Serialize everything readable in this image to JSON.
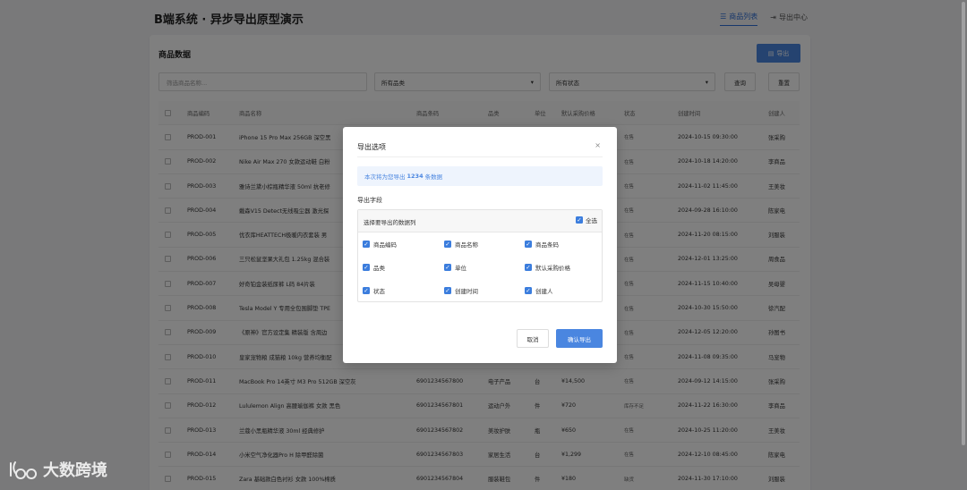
{
  "app": {
    "title": "B端系统 · 异步导出原型演示"
  },
  "nav": [
    {
      "label": "商品列表",
      "icon": "list-icon",
      "active": true
    },
    {
      "label": "导出中心",
      "icon": "export-icon",
      "active": false
    }
  ],
  "card": {
    "title": "商品数据",
    "export_label": "导出"
  },
  "filters": {
    "search_placeholder": "筛选商品名称...",
    "category_value": "所有品类",
    "status_value": "所有状态",
    "query_label": "查询",
    "reset_label": "重置"
  },
  "table": {
    "headers": [
      "商品编码",
      "商品名称",
      "商品条码",
      "品类",
      "单位",
      "默认采购价格",
      "状态",
      "创建时间",
      "创建人"
    ],
    "rows": [
      [
        "PROD-001",
        "iPhone 15 Pro Max 256GB 深空黑",
        "",
        "",
        "",
        "",
        "在售",
        "2024-10-15 09:30:00",
        "张采购"
      ],
      [
        "PROD-002",
        "Nike Air Max 270 女款运动鞋 白粉",
        "",
        "",
        "",
        "",
        "在售",
        "2024-10-18 14:20:00",
        "李商品"
      ],
      [
        "PROD-003",
        "雅诗兰黛小棕瓶精华液 50ml 抗老修",
        "",
        "",
        "",
        "",
        "在售",
        "2024-11-02 11:45:00",
        "王美妆"
      ],
      [
        "PROD-004",
        "戴森V15 Detect无线吸尘器 激光探",
        "",
        "",
        "",
        "",
        "在售",
        "2024-09-28 16:10:00",
        "陈家电"
      ],
      [
        "PROD-005",
        "优衣库HEATTECH极暖内衣套装 男",
        "",
        "",
        "",
        "",
        "在售",
        "2024-11-20 08:15:00",
        "刘服装"
      ],
      [
        "PROD-006",
        "三只松鼠坚果大礼包 1.25kg 混合装",
        "",
        "",
        "",
        "",
        "在售",
        "2024-12-01 13:25:00",
        "周食品"
      ],
      [
        "PROD-007",
        "好奇铂金装纸尿裤 L码 84片装",
        "",
        "",
        "",
        "",
        "在售",
        "2024-11-15 10:40:00",
        "吴母婴"
      ],
      [
        "PROD-008",
        "Tesla Model Y 专用全包围脚垫 TPE",
        "",
        "",
        "",
        "",
        "在售",
        "2024-10-30 15:50:00",
        "徐汽配"
      ],
      [
        "PROD-009",
        "《原神》官方设定集 精装版 含周边",
        "",
        "",
        "",
        "",
        "在售",
        "2024-12-05 12:20:00",
        "孙图书"
      ],
      [
        "PROD-010",
        "皇家宠物粮 成猫粮 10kg 营养均衡配",
        "",
        "",
        "",
        "",
        "在售",
        "2024-11-08 09:35:00",
        "马宠物"
      ],
      [
        "PROD-011",
        "MacBook Pro 14英寸 M3 Pro 512GB 深空灰",
        "6901234567800",
        "电子产品",
        "台",
        "¥14,500",
        "在售",
        "2024-09-12 14:15:00",
        "张采购"
      ],
      [
        "PROD-012",
        "Lululemon Align 高腰瑜伽裤 女款 黑色",
        "6901234567801",
        "运动户外",
        "件",
        "¥720",
        "库存不足",
        "2024-11-22 16:30:00",
        "李商品"
      ],
      [
        "PROD-013",
        "兰蔻小黑瓶精华液 30ml 经典修护",
        "6901234567802",
        "美妆护肤",
        "瓶",
        "¥650",
        "在售",
        "2024-10-25 11:20:00",
        "王美妆"
      ],
      [
        "PROD-014",
        "小米空气净化器Pro H 除甲醛除菌",
        "6901234567803",
        "家居生活",
        "台",
        "¥1,299",
        "在售",
        "2024-12-10 08:45:00",
        "陈家电"
      ],
      [
        "PROD-015",
        "Zara 基础款白色衬衫 女款 100%棉质",
        "6901234567804",
        "服装鞋包",
        "件",
        "¥180",
        "缺货",
        "2024-11-30 17:10:00",
        "刘服装"
      ]
    ]
  },
  "modal": {
    "title": "导出选项",
    "close_glyph": "×",
    "info_prefix": "本次将为您导出",
    "info_count": "1234",
    "info_suffix": "条数据",
    "field_label": "导出字段",
    "panel_head": "选择要导出的数据列",
    "select_all": "全选",
    "options": [
      "商品编码",
      "商品名称",
      "商品条码",
      "品类",
      "单位",
      "默认采购价格",
      "状态",
      "创建时间",
      "创建人"
    ],
    "cancel_label": "取消",
    "confirm_label": "确认导出"
  },
  "watermark": {
    "text": "大数跨境"
  },
  "colors": {
    "primary": "#4a86e0",
    "overlay": "rgba(0,0,0,0.5)"
  }
}
